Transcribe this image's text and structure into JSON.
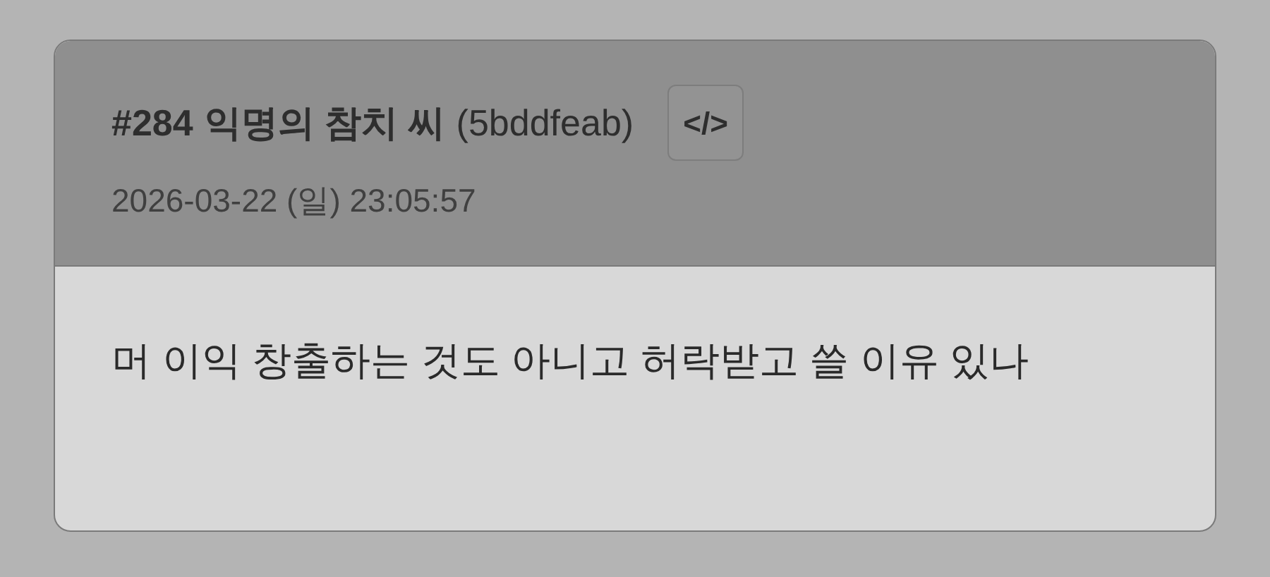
{
  "post": {
    "number": "#284",
    "author": "익명의 참치 씨",
    "id": "(5bddfeab)",
    "code_button": "</>",
    "date": "2026-03-22 (일) 23:05:57",
    "body": "머 이익 창출하는 것도 아니고 허락받고 쓸 이유 있나"
  }
}
